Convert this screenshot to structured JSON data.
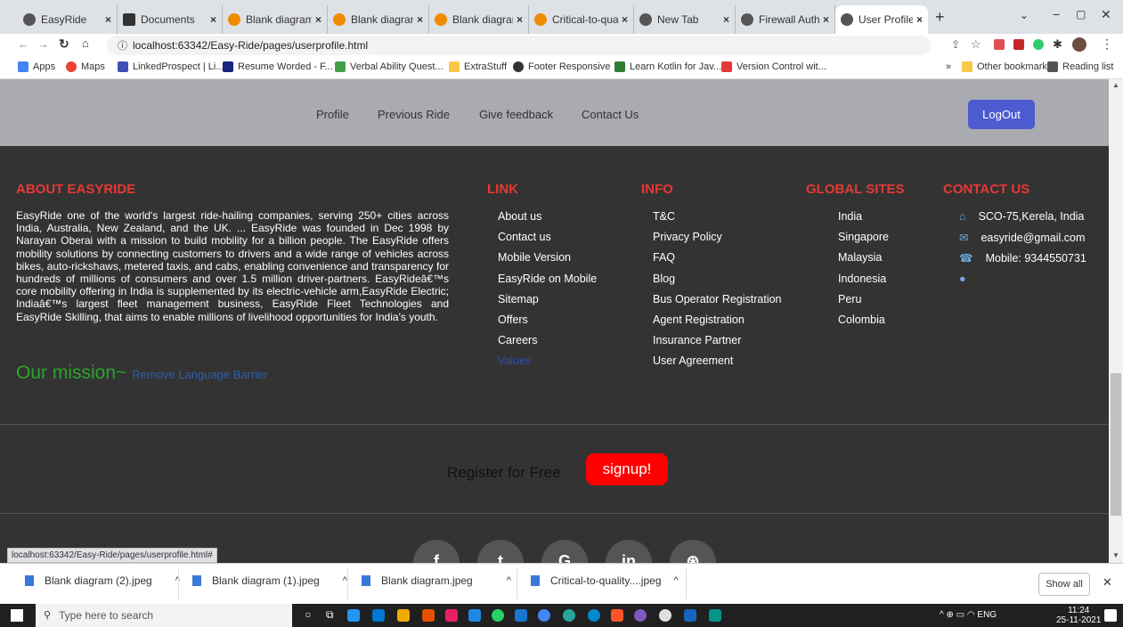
{
  "browser": {
    "tabs": [
      {
        "label": "EasyRide",
        "color": "#555"
      },
      {
        "label": "Documents",
        "color": "#333"
      },
      {
        "label": "Blank diagram",
        "color": "#f08c00"
      },
      {
        "label": "Blank diagram",
        "color": "#f08c00"
      },
      {
        "label": "Blank diagram",
        "color": "#f08c00"
      },
      {
        "label": "Critical-to-qua",
        "color": "#f08c00"
      },
      {
        "label": "New Tab",
        "color": "#555"
      },
      {
        "label": "Firewall Authe",
        "color": "#555"
      },
      {
        "label": "User Profile",
        "color": "#555"
      }
    ],
    "url": "localhost:63342/Easy-Ride/pages/userprofile.html",
    "bookmarks": [
      "Apps",
      "Maps",
      "LinkedProspect | Li...",
      "Resume Worded - F...",
      "Verbal Ability Quest...",
      "ExtraStuff",
      "Footer Responsive",
      "Learn Kotlin for Jav...",
      "Version Control wit..."
    ],
    "other_bookmarks": "Other bookmarks",
    "reading_list": "Reading list",
    "status_url": "localhost:63342/Easy-Ride/pages/userprofile.html#"
  },
  "nav": {
    "links": [
      "Profile",
      "Previous Ride",
      "Give feedback",
      "Contact Us"
    ],
    "logout": "LogOut"
  },
  "footer": {
    "about_title": "ABOUT EASYRIDE",
    "about_text": "EasyRide one of the world's largest ride-hailing companies, serving 250+ cities across India, Australia, New Zealand, and the UK. ... EasyRide was founded in Dec 1998 by Narayan Oberai with a mission to build mobility for a billion people. The EasyRide offers mobility solutions by connecting customers to drivers and a wide range of vehicles across bikes, auto-rickshaws, metered taxis, and cabs, enabling convenience and transparency for hundreds of millions of consumers and over 1.5 million driver-partners. EasyRideâ€™s core mobility offering in India is supplemented by its electric-vehicle arm,EasyRide Electric; Indiaâ€™s largest fleet management business, EasyRide Fleet Technologies and EasyRide Skilling, that aims to enable millions of livelihood opportunities for India's youth.",
    "mission_label": "Our mission~",
    "mission_text": "Remove Language Barrier",
    "link_title": "LINK",
    "links": [
      "About us",
      "Contact us",
      "Mobile Version",
      "EasyRide on Mobile",
      "Sitemap",
      "Offers",
      "Careers",
      "Values"
    ],
    "info_title": "INFO",
    "info": [
      "T&C",
      "Privacy Policy",
      "FAQ",
      "Blog",
      "Bus Operator Registration",
      "Agent Registration",
      "Insurance Partner",
      "User Agreement"
    ],
    "global_title": "GLOBAL SITES",
    "global": [
      "India",
      "Singapore",
      "Malaysia",
      "Indonesia",
      "Peru",
      "Colombia"
    ],
    "contact_title": "CONTACT US",
    "contact": {
      "address": "SCO-75,Kerela, India",
      "email": "easyride@gmail.com",
      "mobile": "Mobile: 9344550731"
    },
    "register_text": "Register for Free",
    "signup": "signup!",
    "social": [
      "f",
      "t",
      "G",
      "in",
      "⊛"
    ]
  },
  "downloads": {
    "items": [
      "Blank diagram (2).jpeg",
      "Blank diagram (1).jpeg",
      "Blank diagram.jpeg",
      "Critical-to-quality....jpeg"
    ],
    "show_all": "Show all"
  },
  "taskbar": {
    "search_placeholder": "Type here to search",
    "time": "11:24",
    "date": "25-11-2021",
    "lang": "ENG"
  }
}
